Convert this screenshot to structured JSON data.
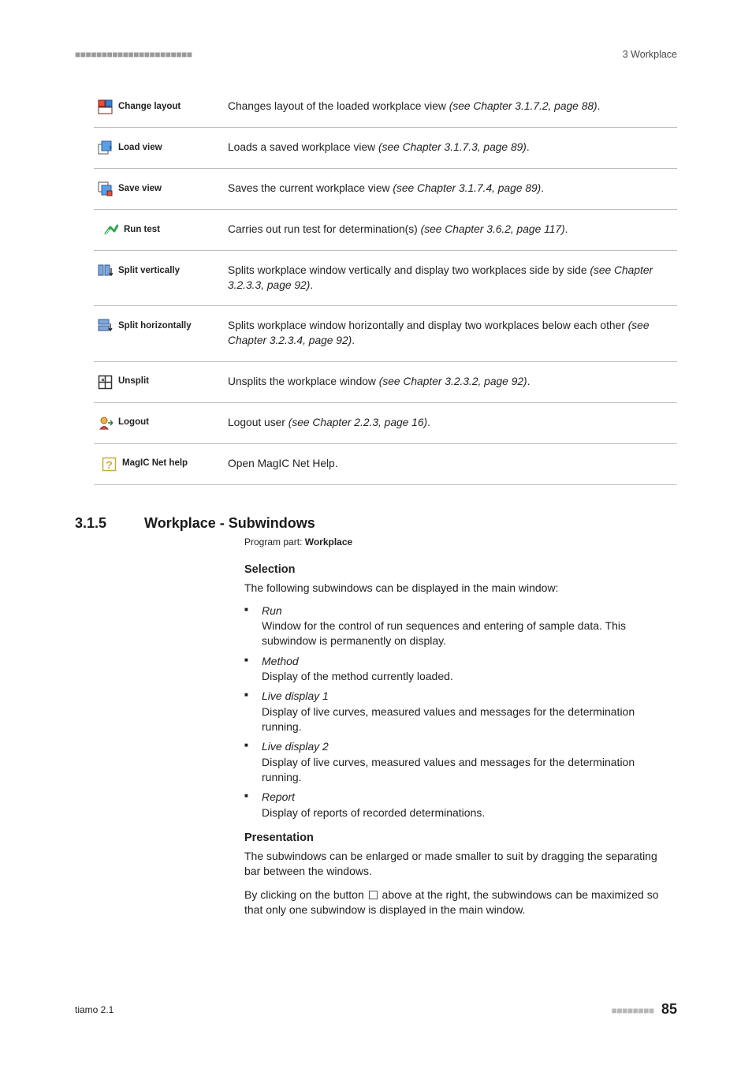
{
  "header": {
    "dashes": "■■■■■■■■■■■■■■■■■■■■■■",
    "chapter": "3 Workplace"
  },
  "rows": [
    {
      "icon": "change-layout-icon",
      "label": "Change layout",
      "desc_pre": "Changes layout of the loaded workplace view ",
      "desc_ital": "(see Chapter 3.1.7.2, page 88)",
      "desc_post": "."
    },
    {
      "icon": "load-view-icon",
      "label": "Load view",
      "desc_pre": "Loads a saved workplace view ",
      "desc_ital": "(see Chapter 3.1.7.3, page 89)",
      "desc_post": "."
    },
    {
      "icon": "save-view-icon",
      "label": "Save view",
      "desc_pre": "Saves the current workplace view ",
      "desc_ital": "(see Chapter 3.1.7.4, page 89)",
      "desc_post": "."
    },
    {
      "icon": "run-test-icon",
      "label": "Run test",
      "desc_pre": "Carries out run test for determination(s) ",
      "desc_ital": "(see Chapter 3.6.2, page 117)",
      "desc_post": "."
    },
    {
      "icon": "split-vertically-icon",
      "label": "Split vertically",
      "desc_pre": "Splits workplace window vertically and display two workplaces side by side ",
      "desc_ital": "(see Chapter 3.2.3.3, page 92)",
      "desc_post": "."
    },
    {
      "icon": "split-horizontally-icon",
      "label": "Split horizontally",
      "desc_pre": "Splits workplace window horizontally and display two workplaces below each other ",
      "desc_ital": "(see Chapter 3.2.3.4, page 92)",
      "desc_post": "."
    },
    {
      "icon": "unsplit-icon",
      "label": "Unsplit",
      "desc_pre": "Unsplits the workplace window ",
      "desc_ital": "(see Chapter 3.2.3.2, page 92)",
      "desc_post": "."
    },
    {
      "icon": "logout-icon",
      "label": "Logout",
      "desc_pre": "Logout user ",
      "desc_ital": "(see Chapter 2.2.3, page 16)",
      "desc_post": "."
    },
    {
      "icon": "help-icon",
      "label": "MagIC Net help",
      "desc_pre": "Open MagIC Net Help.",
      "desc_ital": "",
      "desc_post": ""
    }
  ],
  "section": {
    "num": "3.1.5",
    "title": "Workplace - Subwindows",
    "program_label": "Program part: ",
    "program_value": "Workplace"
  },
  "selection": {
    "head": "Selection",
    "intro": "The following subwindows can be displayed in the main window:",
    "items": [
      {
        "title": "Run",
        "body": "Window for the control of run sequences and entering of sample data. This subwindow is permanently on display."
      },
      {
        "title": "Method",
        "body": "Display of the method currently loaded."
      },
      {
        "title": "Live display 1",
        "body": "Display of live curves, measured values and messages for the determination running."
      },
      {
        "title": "Live display 2",
        "body": "Display of live curves, measured values and messages for the determination running."
      },
      {
        "title": "Report",
        "body": "Display of reports of recorded determinations."
      }
    ]
  },
  "presentation": {
    "head": "Presentation",
    "p1": "The subwindows can be enlarged or made smaller to suit by dragging the separating bar between the windows.",
    "p2a": "By clicking on the button ",
    "p2b": " above at the right, the subwindows can be maximized so that only one subwindow is displayed in the main window."
  },
  "footer": {
    "product": "tiamo 2.1",
    "dashes": "■■■■■■■■",
    "page": "85"
  }
}
